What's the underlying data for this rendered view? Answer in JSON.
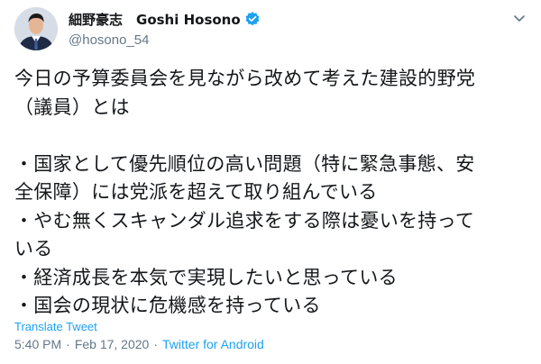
{
  "author": {
    "name": "細野豪志　Goshi Hosono",
    "handle": "@hosono_54",
    "verified_icon": "verified-badge-icon",
    "avatar_icon": "profile-photo"
  },
  "menu_icon": "chevron-down-icon",
  "tweet": {
    "lines": [
      "今日の予算委員会を見ながら改めて考えた建設的野党",
      "（議員）とは",
      "",
      "・国家として優先順位の高い問題（特に緊急事態、安",
      "全保障）には党派を超えて取り組んでいる",
      "・やむ無くスキャンダル追求をする際は憂いを持って",
      "いる",
      "・経済成長を本気で実現したいと思っている",
      "・国会の現状に危機感を持っている"
    ]
  },
  "translate_label": "Translate Tweet",
  "meta": {
    "time": "5:40 PM",
    "separator1": "·",
    "date": "Feb 17, 2020",
    "separator2": "·",
    "source": "Twitter for Android"
  },
  "colors": {
    "text": "#14171a",
    "secondary": "#657786",
    "accent": "#1da1f2"
  }
}
